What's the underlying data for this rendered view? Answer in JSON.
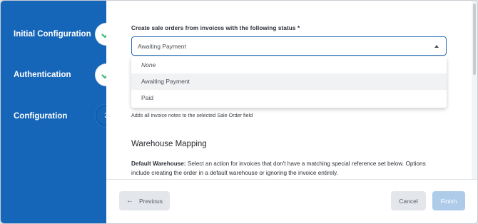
{
  "sidebar": {
    "steps": [
      {
        "label": "Initial Configuration",
        "state": "done"
      },
      {
        "label": "Authentication",
        "state": "done"
      },
      {
        "label": "Configuration",
        "state": "current",
        "number": "3"
      }
    ]
  },
  "form": {
    "status_label": "Create sale orders from invoices with the following status",
    "required_marker": "*",
    "status_selected": "Awaiting Payment",
    "status_options": [
      "None",
      "Awaiting Payment",
      "Paid"
    ],
    "notes_helper": "Adds all invoice notes to the selected Sale Order field",
    "warehouse_section_title": "Warehouse Mapping",
    "default_warehouse_label": "Default Warehouse:",
    "default_warehouse_desc": "Select an action for invoices that don't have a matching special reference set below. Options include creating the order in a default warehouse or ignoring the invoice entirely."
  },
  "footer": {
    "previous_label": "Previous",
    "cancel_label": "Cancel",
    "finish_label": "Finish"
  },
  "colors": {
    "sidebar": "#1565b8",
    "check": "#3bb57a",
    "focus_border": "#2f6fb8",
    "finish_disabled": "#aecbea"
  },
  "icons": {
    "check": "check-icon",
    "caret": "caret-up-icon",
    "previous": "arrow-left-icon"
  }
}
